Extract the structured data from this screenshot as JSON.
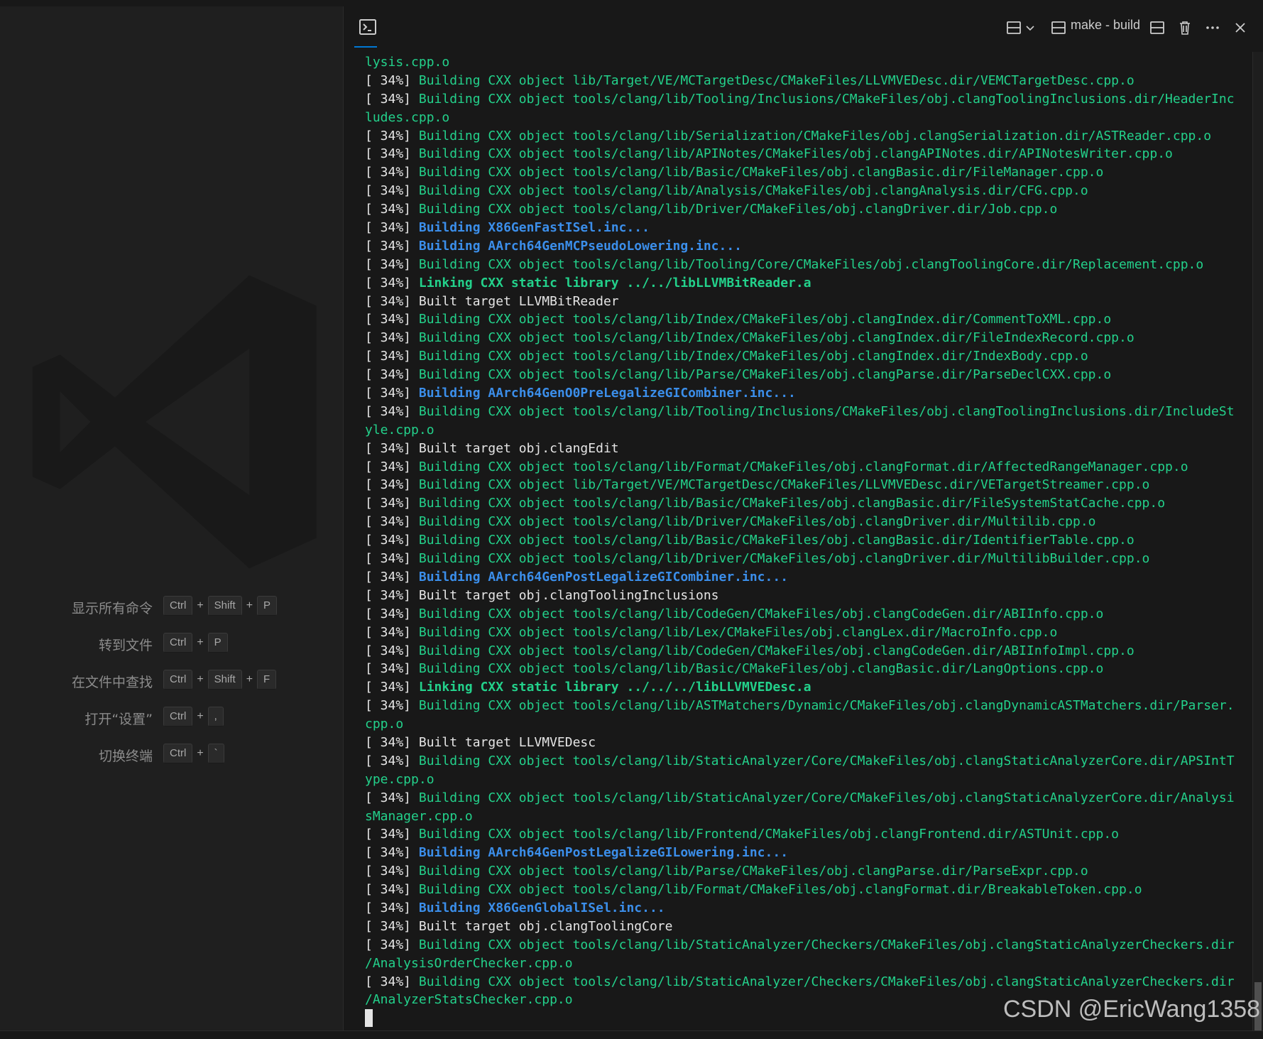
{
  "welcome": {
    "shortcuts": [
      {
        "label": "显示所有命令",
        "keys": [
          "Ctrl",
          "Shift",
          "P"
        ]
      },
      {
        "label": "转到文件",
        "keys": [
          "Ctrl",
          "P"
        ]
      },
      {
        "label": "在文件中查找",
        "keys": [
          "Ctrl",
          "Shift",
          "F"
        ]
      },
      {
        "label": "打开“设置”",
        "keys": [
          "Ctrl",
          ","
        ]
      },
      {
        "label": "切换终端",
        "keys": [
          "Ctrl",
          "`"
        ]
      }
    ]
  },
  "terminal": {
    "name": "make - build",
    "icons": {
      "tab": "terminal-icon",
      "split_dropdown": "split-layout-icon",
      "chevron": "chevron-down-icon",
      "instance": "terminal-panel-icon",
      "split": "split-terminal-icon",
      "kill": "trash-icon",
      "more": "more-actions-icon",
      "close": "close-icon"
    },
    "lines": [
      {
        "prefix": "",
        "text": "lysis.cpp.o",
        "style": "g"
      },
      {
        "prefix": "[ 34%] ",
        "text": "Building CXX object lib/Target/VE/MCTargetDesc/CMakeFiles/LLVMVEDesc.dir/VEMCTargetDesc.cpp.o",
        "style": "g"
      },
      {
        "prefix": "[ 34%] ",
        "text": "Building CXX object tools/clang/lib/Tooling/Inclusions/CMakeFiles/obj.clangToolingInclusions.dir/HeaderInc",
        "style": "g"
      },
      {
        "prefix": "",
        "text": "ludes.cpp.o",
        "style": "g"
      },
      {
        "prefix": "[ 34%] ",
        "text": "Building CXX object tools/clang/lib/Serialization/CMakeFiles/obj.clangSerialization.dir/ASTReader.cpp.o",
        "style": "g"
      },
      {
        "prefix": "[ 34%] ",
        "text": "Building CXX object tools/clang/lib/APINotes/CMakeFiles/obj.clangAPINotes.dir/APINotesWriter.cpp.o",
        "style": "g"
      },
      {
        "prefix": "[ 34%] ",
        "text": "Building CXX object tools/clang/lib/Basic/CMakeFiles/obj.clangBasic.dir/FileManager.cpp.o",
        "style": "g"
      },
      {
        "prefix": "[ 34%] ",
        "text": "Building CXX object tools/clang/lib/Analysis/CMakeFiles/obj.clangAnalysis.dir/CFG.cpp.o",
        "style": "g"
      },
      {
        "prefix": "[ 34%] ",
        "text": "Building CXX object tools/clang/lib/Driver/CMakeFiles/obj.clangDriver.dir/Job.cpp.o",
        "style": "g"
      },
      {
        "prefix": "[ 34%] ",
        "text": "Building X86GenFastISel.inc...",
        "style": "b"
      },
      {
        "prefix": "[ 34%] ",
        "text": "Building AArch64GenMCPseudoLowering.inc...",
        "style": "b"
      },
      {
        "prefix": "[ 34%] ",
        "text": "Building CXX object tools/clang/lib/Tooling/Core/CMakeFiles/obj.clangToolingCore.dir/Replacement.cpp.o",
        "style": "g"
      },
      {
        "prefix": "[ 34%] ",
        "text": "Linking CXX static library ../../libLLVMBitReader.a",
        "style": "gb"
      },
      {
        "prefix": "[ 34%] ",
        "text": "Built target LLVMBitReader",
        "style": "w"
      },
      {
        "prefix": "[ 34%] ",
        "text": "Building CXX object tools/clang/lib/Index/CMakeFiles/obj.clangIndex.dir/CommentToXML.cpp.o",
        "style": "g"
      },
      {
        "prefix": "[ 34%] ",
        "text": "Building CXX object tools/clang/lib/Index/CMakeFiles/obj.clangIndex.dir/FileIndexRecord.cpp.o",
        "style": "g"
      },
      {
        "prefix": "[ 34%] ",
        "text": "Building CXX object tools/clang/lib/Index/CMakeFiles/obj.clangIndex.dir/IndexBody.cpp.o",
        "style": "g"
      },
      {
        "prefix": "[ 34%] ",
        "text": "Building CXX object tools/clang/lib/Parse/CMakeFiles/obj.clangParse.dir/ParseDeclCXX.cpp.o",
        "style": "g"
      },
      {
        "prefix": "[ 34%] ",
        "text": "Building AArch64GenO0PreLegalizeGICombiner.inc...",
        "style": "b"
      },
      {
        "prefix": "[ 34%] ",
        "text": "Building CXX object tools/clang/lib/Tooling/Inclusions/CMakeFiles/obj.clangToolingInclusions.dir/IncludeSt",
        "style": "g"
      },
      {
        "prefix": "",
        "text": "yle.cpp.o",
        "style": "g"
      },
      {
        "prefix": "[ 34%] ",
        "text": "Built target obj.clangEdit",
        "style": "w"
      },
      {
        "prefix": "[ 34%] ",
        "text": "Building CXX object tools/clang/lib/Format/CMakeFiles/obj.clangFormat.dir/AffectedRangeManager.cpp.o",
        "style": "g"
      },
      {
        "prefix": "[ 34%] ",
        "text": "Building CXX object lib/Target/VE/MCTargetDesc/CMakeFiles/LLVMVEDesc.dir/VETargetStreamer.cpp.o",
        "style": "g"
      },
      {
        "prefix": "[ 34%] ",
        "text": "Building CXX object tools/clang/lib/Basic/CMakeFiles/obj.clangBasic.dir/FileSystemStatCache.cpp.o",
        "style": "g"
      },
      {
        "prefix": "[ 34%] ",
        "text": "Building CXX object tools/clang/lib/Driver/CMakeFiles/obj.clangDriver.dir/Multilib.cpp.o",
        "style": "g"
      },
      {
        "prefix": "[ 34%] ",
        "text": "Building CXX object tools/clang/lib/Basic/CMakeFiles/obj.clangBasic.dir/IdentifierTable.cpp.o",
        "style": "g"
      },
      {
        "prefix": "[ 34%] ",
        "text": "Building CXX object tools/clang/lib/Driver/CMakeFiles/obj.clangDriver.dir/MultilibBuilder.cpp.o",
        "style": "g"
      },
      {
        "prefix": "[ 34%] ",
        "text": "Building AArch64GenPostLegalizeGICombiner.inc...",
        "style": "b"
      },
      {
        "prefix": "[ 34%] ",
        "text": "Built target obj.clangToolingInclusions",
        "style": "w"
      },
      {
        "prefix": "[ 34%] ",
        "text": "Building CXX object tools/clang/lib/CodeGen/CMakeFiles/obj.clangCodeGen.dir/ABIInfo.cpp.o",
        "style": "g"
      },
      {
        "prefix": "[ 34%] ",
        "text": "Building CXX object tools/clang/lib/Lex/CMakeFiles/obj.clangLex.dir/MacroInfo.cpp.o",
        "style": "g"
      },
      {
        "prefix": "[ 34%] ",
        "text": "Building CXX object tools/clang/lib/CodeGen/CMakeFiles/obj.clangCodeGen.dir/ABIInfoImpl.cpp.o",
        "style": "g"
      },
      {
        "prefix": "[ 34%] ",
        "text": "Building CXX object tools/clang/lib/Basic/CMakeFiles/obj.clangBasic.dir/LangOptions.cpp.o",
        "style": "g"
      },
      {
        "prefix": "[ 34%] ",
        "text": "Linking CXX static library ../../../libLLVMVEDesc.a",
        "style": "gb"
      },
      {
        "prefix": "[ 34%] ",
        "text": "Building CXX object tools/clang/lib/ASTMatchers/Dynamic/CMakeFiles/obj.clangDynamicASTMatchers.dir/Parser.",
        "style": "g"
      },
      {
        "prefix": "",
        "text": "cpp.o",
        "style": "g"
      },
      {
        "prefix": "[ 34%] ",
        "text": "Built target LLVMVEDesc",
        "style": "w"
      },
      {
        "prefix": "[ 34%] ",
        "text": "Building CXX object tools/clang/lib/StaticAnalyzer/Core/CMakeFiles/obj.clangStaticAnalyzerCore.dir/APSIntT",
        "style": "g"
      },
      {
        "prefix": "",
        "text": "ype.cpp.o",
        "style": "g"
      },
      {
        "prefix": "[ 34%] ",
        "text": "Building CXX object tools/clang/lib/StaticAnalyzer/Core/CMakeFiles/obj.clangStaticAnalyzerCore.dir/Analysi",
        "style": "g"
      },
      {
        "prefix": "",
        "text": "sManager.cpp.o",
        "style": "g"
      },
      {
        "prefix": "[ 34%] ",
        "text": "Building CXX object tools/clang/lib/Frontend/CMakeFiles/obj.clangFrontend.dir/ASTUnit.cpp.o",
        "style": "g"
      },
      {
        "prefix": "[ 34%] ",
        "text": "Building AArch64GenPostLegalizeGILowering.inc...",
        "style": "b"
      },
      {
        "prefix": "[ 34%] ",
        "text": "Building CXX object tools/clang/lib/Parse/CMakeFiles/obj.clangParse.dir/ParseExpr.cpp.o",
        "style": "g"
      },
      {
        "prefix": "[ 34%] ",
        "text": "Building CXX object tools/clang/lib/Format/CMakeFiles/obj.clangFormat.dir/BreakableToken.cpp.o",
        "style": "g"
      },
      {
        "prefix": "[ 34%] ",
        "text": "Building X86GenGlobalISel.inc...",
        "style": "b"
      },
      {
        "prefix": "[ 34%] ",
        "text": "Built target obj.clangToolingCore",
        "style": "w"
      },
      {
        "prefix": "[ 34%] ",
        "text": "Building CXX object tools/clang/lib/StaticAnalyzer/Checkers/CMakeFiles/obj.clangStaticAnalyzerCheckers.dir",
        "style": "g"
      },
      {
        "prefix": "",
        "text": "/AnalysisOrderChecker.cpp.o",
        "style": "g"
      },
      {
        "prefix": "[ 34%] ",
        "text": "Building CXX object tools/clang/lib/StaticAnalyzer/Checkers/CMakeFiles/obj.clangStaticAnalyzerCheckers.dir",
        "style": "g"
      },
      {
        "prefix": "",
        "text": "/AnalyzerStatsChecker.cpp.o",
        "style": "g"
      }
    ]
  },
  "watermark": "CSDN @EricWang1358",
  "colors": {
    "green": "#23d18b",
    "blue": "#3b8eea",
    "white": "#e5e5e5",
    "accent": "#0078d4"
  }
}
